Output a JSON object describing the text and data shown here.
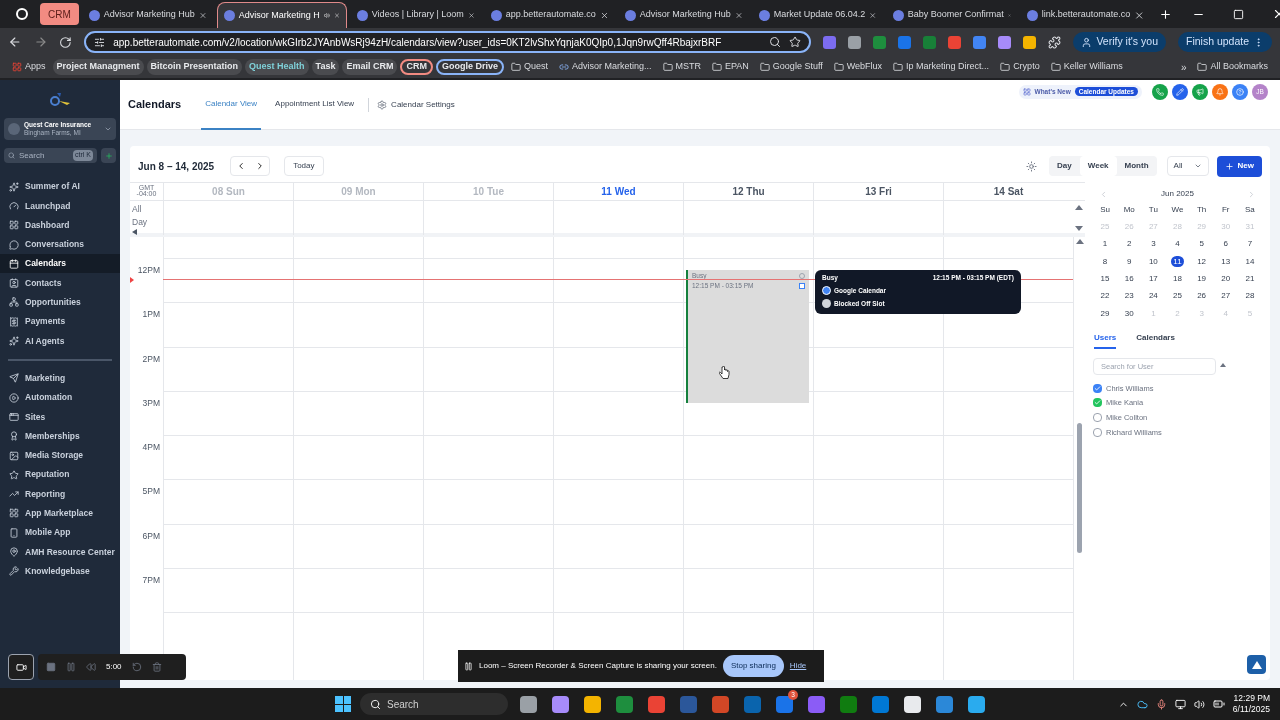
{
  "browser": {
    "tabs": [
      {
        "title": "CRM",
        "kind": "pinned",
        "selected": false
      },
      {
        "title": "Advisor Marketing Hub",
        "kind": "tab",
        "selected": false
      },
      {
        "title": "Advisor Marketing H",
        "kind": "tab",
        "selected": true
      },
      {
        "title": "Videos | Library | Loom",
        "kind": "tab",
        "selected": false
      },
      {
        "title": "app.betterautomate.co",
        "kind": "tab",
        "selected": false
      },
      {
        "title": "Advisor Marketing Hub",
        "kind": "tab",
        "selected": false
      },
      {
        "title": "Market Update 06.04.2",
        "kind": "tab",
        "selected": false
      },
      {
        "title": "Baby Boomer Confirmat",
        "kind": "tab",
        "selected": false
      },
      {
        "title": "link.betterautomate.co",
        "kind": "tab",
        "selected": false
      }
    ],
    "address": "app.betterautomate.com/v2/location/wkGIrb2JYAnbWsRj94zH/calendars/view?user_ids=0KT2lvShxYqnjaK0QIp0,1Jqn9rwQff4RbajxrBRF",
    "verify_button": "Verify it's you",
    "update_button": "Finish update",
    "bookmarks": [
      {
        "label": "Apps",
        "kind": "apps"
      },
      {
        "label": "Project Managment",
        "kind": "chip"
      },
      {
        "label": "Bitcoin Presentation",
        "kind": "chip"
      },
      {
        "label": "Quest Health",
        "kind": "chip",
        "color": "#7fd1d9"
      },
      {
        "label": "Task",
        "kind": "chip"
      },
      {
        "label": "Email CRM",
        "kind": "chip"
      },
      {
        "label": "CRM",
        "kind": "outlined",
        "color": "#f28b82"
      },
      {
        "label": "Google Drive",
        "kind": "outlined",
        "color": "#8ab4f8"
      },
      {
        "label": "Quest",
        "kind": "folder"
      },
      {
        "label": "Advisor Marketing...",
        "kind": "link"
      },
      {
        "label": "MSTR",
        "kind": "folder"
      },
      {
        "label": "EPAN",
        "kind": "folder"
      },
      {
        "label": "Google Stuff",
        "kind": "folder"
      },
      {
        "label": "WebFlux",
        "kind": "folder"
      },
      {
        "label": "Ip Marketing Direct...",
        "kind": "folder"
      },
      {
        "label": "Crypto",
        "kind": "folder"
      },
      {
        "label": "Keller Williams",
        "kind": "folder"
      }
    ],
    "more_bookmarks": "»",
    "all_bookmarks": "All Bookmarks"
  },
  "sidebar": {
    "account": {
      "name": "Quest Care Insurance",
      "location": "Bingham Farms, MI"
    },
    "search": {
      "placeholder": "Search",
      "shortcut": "ctrl K"
    },
    "sections": [
      {
        "items": [
          {
            "label": "Summer of AI",
            "selected": false
          },
          {
            "label": "Launchpad",
            "selected": false
          },
          {
            "label": "Dashboard",
            "selected": false
          },
          {
            "label": "Conversations",
            "selected": false
          },
          {
            "label": "Calendars",
            "selected": true
          },
          {
            "label": "Contacts",
            "selected": false
          },
          {
            "label": "Opportunities",
            "selected": false
          },
          {
            "label": "Payments",
            "selected": false
          },
          {
            "label": "AI Agents",
            "selected": false
          }
        ]
      },
      {
        "items": [
          {
            "label": "Marketing",
            "selected": false
          },
          {
            "label": "Automation",
            "selected": false
          },
          {
            "label": "Sites",
            "selected": false
          },
          {
            "label": "Memberships",
            "selected": false
          },
          {
            "label": "Media Storage",
            "selected": false
          },
          {
            "label": "Reputation",
            "selected": false
          },
          {
            "label": "Reporting",
            "selected": false
          },
          {
            "label": "App Marketplace",
            "selected": false
          },
          {
            "label": "Mobile App",
            "selected": false
          },
          {
            "label": "AMH Resource Center",
            "selected": false
          },
          {
            "label": "Knowledgebase",
            "selected": false
          }
        ]
      }
    ]
  },
  "header": {
    "title": "Calendars",
    "tabs": [
      {
        "label": "Calendar View",
        "selected": true
      },
      {
        "label": "Appointment List View",
        "selected": false
      }
    ],
    "settings": "Calendar Settings",
    "whats_new": "What's New",
    "updates_badge": "Calendar Updates",
    "avatar": "JB"
  },
  "calendar": {
    "range": "Jun 8 – 14, 2025",
    "today_button": "Today",
    "views": [
      {
        "label": "Day",
        "selected": false
      },
      {
        "label": "Week",
        "selected": true
      },
      {
        "label": "Month",
        "selected": false
      }
    ],
    "filter": "All",
    "new_button": "New",
    "timezone": "GMT",
    "offset": "-04:00",
    "all_day": "All Day",
    "days": [
      {
        "label": "08 Sun",
        "selected": false
      },
      {
        "label": "09 Mon",
        "selected": false
      },
      {
        "label": "10 Tue",
        "selected": false
      },
      {
        "label": "11 Wed",
        "selected": true
      },
      {
        "label": "12 Thu",
        "selected": false,
        "events": [
          {
            "title": "Busy",
            "time": "12:15 PM - 03:15 PM",
            "color": "#15803d"
          }
        ]
      },
      {
        "label": "13 Fri",
        "selected": false
      },
      {
        "label": "14 Sat",
        "selected": false
      }
    ],
    "hours": [
      "12PM",
      "1PM",
      "2PM",
      "3PM",
      "4PM",
      "5PM",
      "6PM",
      "7PM"
    ],
    "tooltip": {
      "title": "Busy",
      "time": "12:15 PM - 03:15 PM (EDT)",
      "lines": [
        "Google Calendar",
        "Blocked Off Slot"
      ]
    }
  },
  "mini_calendar": {
    "month": "Jun 2025",
    "weekdays": [
      "Su",
      "Mo",
      "Tu",
      "We",
      "Th",
      "Fr",
      "Sa"
    ],
    "days": [
      {
        "day": "25",
        "muted": true,
        "selected": false
      },
      {
        "day": "26",
        "muted": true,
        "selected": false
      },
      {
        "day": "27",
        "muted": true,
        "selected": false
      },
      {
        "day": "28",
        "muted": true,
        "selected": false
      },
      {
        "day": "29",
        "muted": true,
        "selected": false
      },
      {
        "day": "30",
        "muted": true,
        "selected": false
      },
      {
        "day": "31",
        "muted": true,
        "selected": false
      },
      {
        "day": "1",
        "muted": false,
        "selected": false
      },
      {
        "day": "2",
        "muted": false,
        "selected": false
      },
      {
        "day": "3",
        "muted": false,
        "selected": false
      },
      {
        "day": "4",
        "muted": false,
        "selected": false
      },
      {
        "day": "5",
        "muted": false,
        "selected": false
      },
      {
        "day": "6",
        "muted": false,
        "selected": false
      },
      {
        "day": "7",
        "muted": false,
        "selected": false
      },
      {
        "day": "8",
        "muted": false,
        "selected": false
      },
      {
        "day": "9",
        "muted": false,
        "selected": false
      },
      {
        "day": "10",
        "muted": false,
        "selected": false
      },
      {
        "day": "11",
        "muted": false,
        "selected": true
      },
      {
        "day": "12",
        "muted": false,
        "selected": false
      },
      {
        "day": "13",
        "muted": false,
        "selected": false
      },
      {
        "day": "14",
        "muted": false,
        "selected": false
      },
      {
        "day": "15",
        "muted": false,
        "selected": false
      },
      {
        "day": "16",
        "muted": false,
        "selected": false
      },
      {
        "day": "17",
        "muted": false,
        "selected": false
      },
      {
        "day": "18",
        "muted": false,
        "selected": false
      },
      {
        "day": "19",
        "muted": false,
        "selected": false
      },
      {
        "day": "20",
        "muted": false,
        "selected": false
      },
      {
        "day": "21",
        "muted": false,
        "selected": false
      },
      {
        "day": "22",
        "muted": false,
        "selected": false
      },
      {
        "day": "23",
        "muted": false,
        "selected": false
      },
      {
        "day": "24",
        "muted": false,
        "selected": false
      },
      {
        "day": "25",
        "muted": false,
        "selected": false
      },
      {
        "day": "26",
        "muted": false,
        "selected": false
      },
      {
        "day": "27",
        "muted": false,
        "selected": false
      },
      {
        "day": "28",
        "muted": false,
        "selected": false
      },
      {
        "day": "29",
        "muted": false,
        "selected": false
      },
      {
        "day": "30",
        "muted": false,
        "selected": false
      },
      {
        "day": "1",
        "muted": true,
        "selected": false
      },
      {
        "day": "2",
        "muted": true,
        "selected": false
      },
      {
        "day": "3",
        "muted": true,
        "selected": false
      },
      {
        "day": "4",
        "muted": true,
        "selected": false
      },
      {
        "day": "5",
        "muted": true,
        "selected": false
      }
    ]
  },
  "users_panel": {
    "tabs": [
      {
        "label": "Users",
        "selected": true
      },
      {
        "label": "Calendars",
        "selected": false
      }
    ],
    "search_placeholder": "Search for User",
    "users": [
      {
        "name": "Chris Williams",
        "checked": true,
        "color": "#3b82f6"
      },
      {
        "name": "Mike Kania",
        "checked": true,
        "color": "#22c55e"
      },
      {
        "name": "Mike Collton",
        "checked": false
      },
      {
        "name": "Richard Williams",
        "checked": false
      }
    ]
  },
  "loom": {
    "timer": "5:00",
    "message": "Loom – Screen Recorder & Screen Capture is sharing your screen.",
    "stop_button": "Stop sharing",
    "hide_link": "Hide"
  },
  "taskbar": {
    "search": "Search",
    "time": "12:29 PM",
    "date": "6/11/2025",
    "badge": "3"
  }
}
